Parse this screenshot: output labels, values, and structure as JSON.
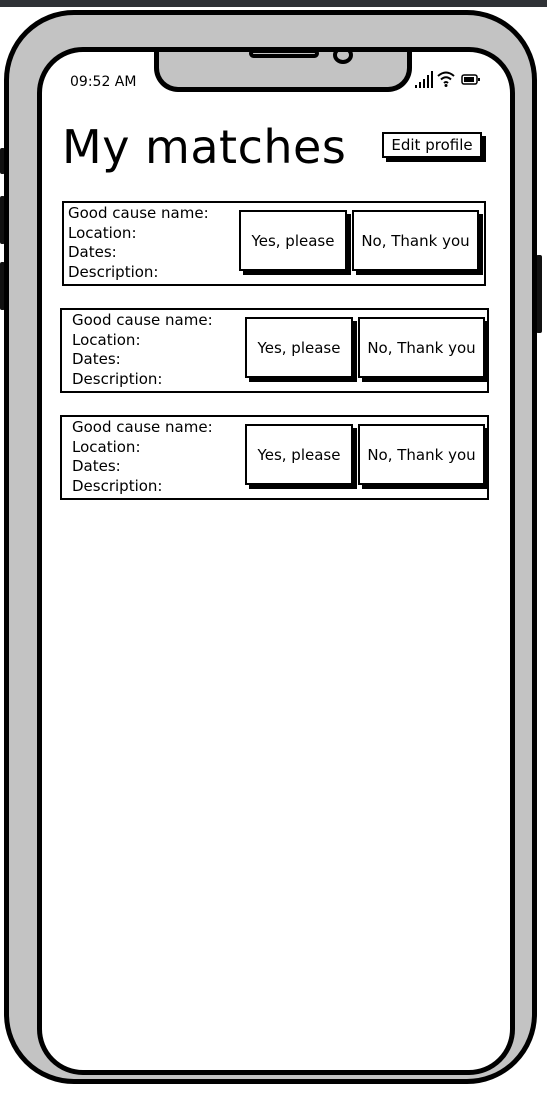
{
  "status": {
    "time": "09:52 AM"
  },
  "page": {
    "title": "My matches",
    "edit_profile_label": "Edit profile"
  },
  "matches": [
    {
      "name_label": "Good cause name:",
      "location_label": "Location:",
      "dates_label": "Dates:",
      "description_label": "Description:",
      "yes_label": "Yes, please",
      "no_label": "No, Thank you"
    },
    {
      "name_label": "Good cause name:",
      "location_label": "Location:",
      "dates_label": "Dates:",
      "description_label": "Description:",
      "yes_label": "Yes, please",
      "no_label": "No, Thank you"
    },
    {
      "name_label": "Good cause name:",
      "location_label": "Location:",
      "dates_label": "Dates:",
      "description_label": "Description:",
      "yes_label": "Yes, please",
      "no_label": "No, Thank you"
    }
  ]
}
